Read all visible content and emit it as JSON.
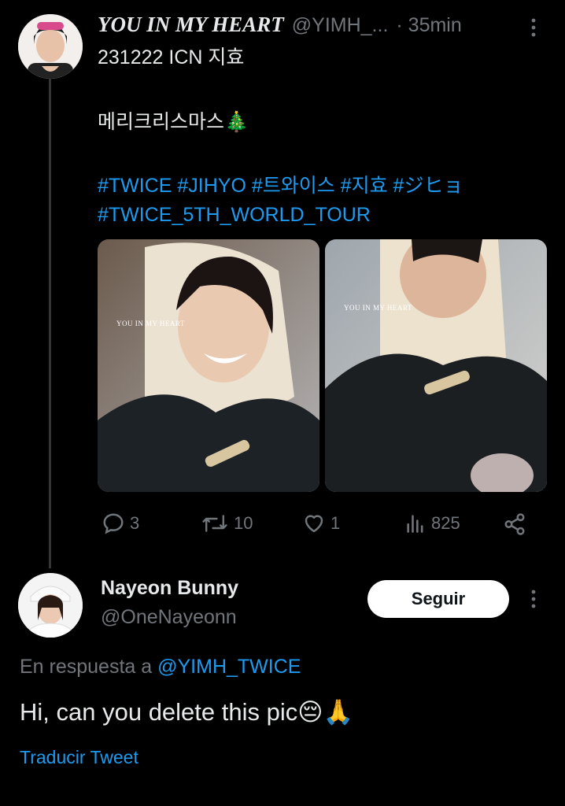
{
  "tweet": {
    "author_name": "YOU IN MY HEART",
    "author_handle": "@YIMH_...",
    "time": "· 35min",
    "line1": "231222 ICN 지효",
    "line2": "메리크리스마스🎄",
    "hashtags_line1": "#TWICE #JIHYO #트와이스 #지효 #ジヒョ",
    "hashtags_line2": "#TWICE_5TH_WORLD_TOUR",
    "watermark": "YOU IN MY HEART",
    "actions": {
      "replies": "3",
      "retweets": "10",
      "likes": "1",
      "views": "825"
    }
  },
  "reply": {
    "author_name": "Nayeon Bunny",
    "author_handle": "@OneNayeonn",
    "follow_label": "Seguir",
    "in_reply_prefix": "En respuesta a",
    "in_reply_handle": "@YIMH_TWICE",
    "text": "Hi, can you delete this pic😔🙏",
    "translate_label": "Traducir Tweet"
  },
  "icons": [
    "more-icon",
    "reply-icon",
    "retweet-icon",
    "like-icon",
    "views-icon",
    "share-icon"
  ],
  "colors": {
    "background": "#000000",
    "link": "#1d9bf0",
    "secondary": "#71767b",
    "primary_text": "#e7e9ea"
  }
}
